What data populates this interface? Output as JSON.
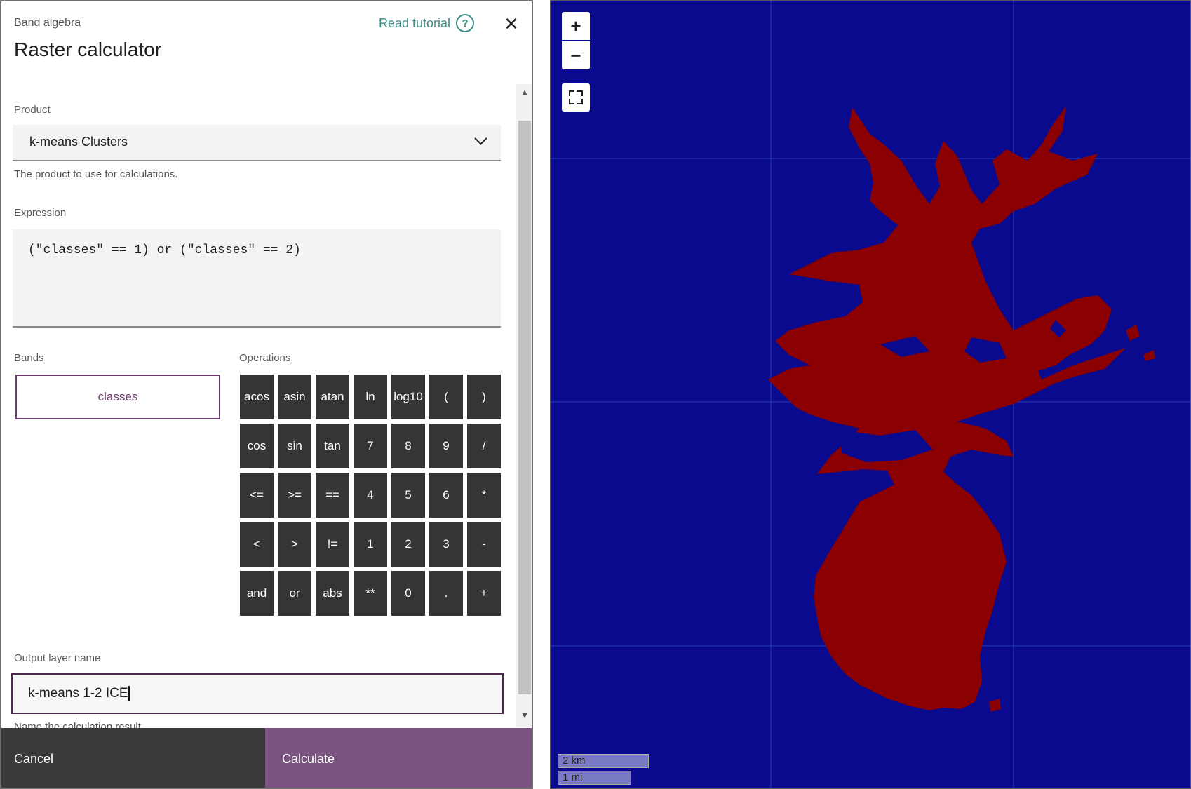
{
  "header": {
    "subtitle": "Band algebra",
    "title": "Raster calculator",
    "tutorial_label": "Read tutorial",
    "tutorial_icon": "question-circle-icon",
    "close_icon": "close-icon",
    "close_glyph": "✕"
  },
  "product": {
    "label": "Product",
    "value": "k-means Clusters",
    "help": "The product to use for calculations."
  },
  "expression": {
    "label": "Expression",
    "value": "(\"classes\" == 1) or (\"classes\" == 2)"
  },
  "bands": {
    "label": "Bands",
    "items": [
      "classes"
    ]
  },
  "operations": {
    "label": "Operations",
    "buttons": [
      "acos",
      "asin",
      "atan",
      "ln",
      "log10",
      "(",
      ")",
      "cos",
      "sin",
      "tan",
      "7",
      "8",
      "9",
      "/",
      "<=",
      ">=",
      "==",
      "4",
      "5",
      "6",
      "*",
      "<",
      ">",
      "!=",
      "1",
      "2",
      "3",
      "-",
      "and",
      "or",
      "abs",
      "**",
      "0",
      ".",
      "+"
    ]
  },
  "output": {
    "label": "Output layer name",
    "value": "k-means 1-2 ICE",
    "help": "Name the calculation result"
  },
  "footer": {
    "cancel_label": "Cancel",
    "calculate_label": "Calculate"
  },
  "map": {
    "zoom_in": "+",
    "zoom_out": "−",
    "scale_km": "2 km",
    "scale_mi": "1 mi",
    "colors": {
      "background": "#0a0a8f",
      "feature": "#8b0000",
      "panel_accent": "#7a5580"
    }
  }
}
